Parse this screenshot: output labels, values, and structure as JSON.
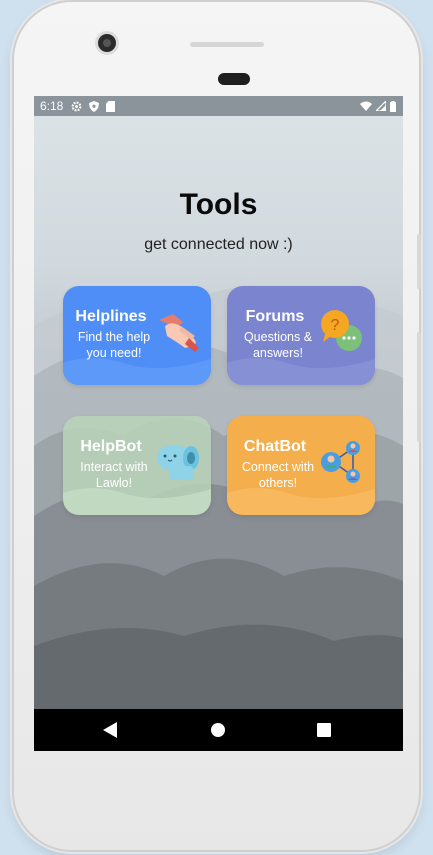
{
  "status_bar": {
    "time": "6:18",
    "left_icons": [
      "settings-icon",
      "shield-icon",
      "sd-card-icon"
    ],
    "right_icons": [
      "wifi-icon",
      "signal-icon",
      "battery-icon"
    ]
  },
  "screen": {
    "title": "Tools",
    "subtitle": "get connected now :)"
  },
  "tools": [
    {
      "title": "Helplines",
      "description": "Find the help you need!",
      "icon": "handshake-icon",
      "color": "#4f8ef7"
    },
    {
      "title": "Forums",
      "description": "Questions & answers!",
      "icon": "chat-bubbles-icon",
      "color": "#7b85cf"
    },
    {
      "title": "HelpBot",
      "description": "Interact with Lawlo!",
      "icon": "robot-icon",
      "color": "#b9d4b8"
    },
    {
      "title": "ChatBot",
      "description": "Connect with others!",
      "icon": "network-icon",
      "color": "#f5ae4c"
    }
  ],
  "nav": {
    "back": "back-icon",
    "home": "home-icon",
    "recents": "recents-icon"
  }
}
